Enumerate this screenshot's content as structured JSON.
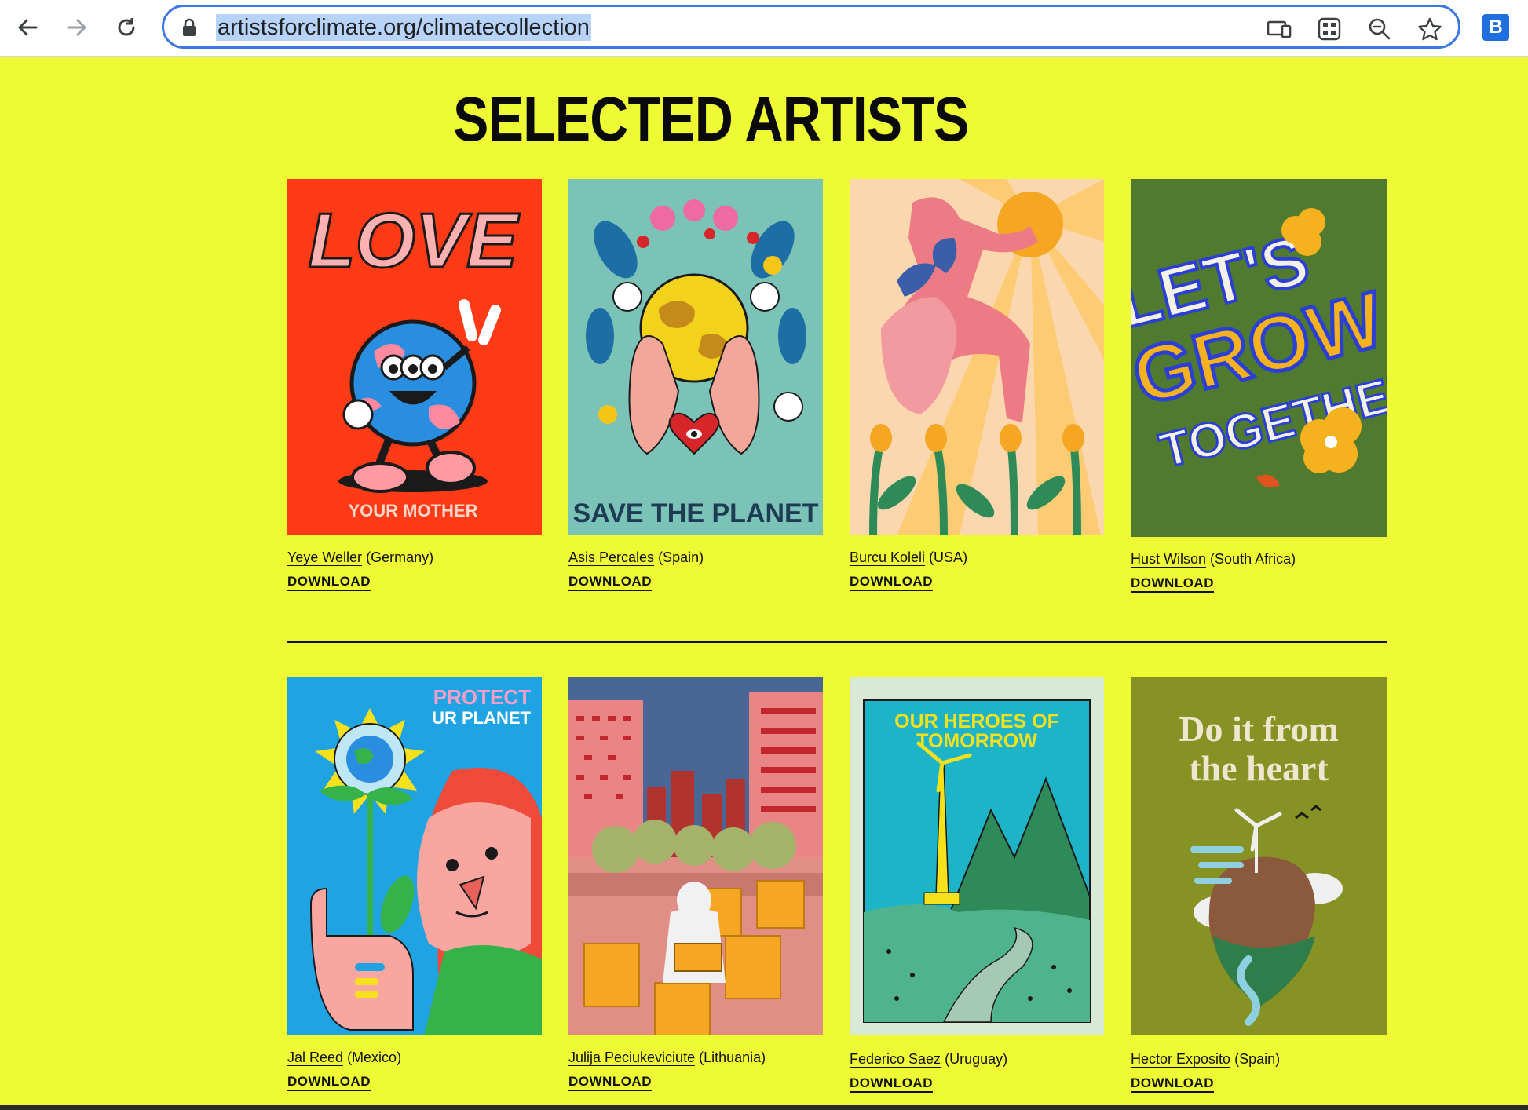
{
  "browser": {
    "url": "artistsforclimate.org/climatecollection",
    "icons": [
      "back-icon",
      "forward-icon",
      "reload-icon",
      "lock-icon",
      "cast-icon",
      "apps-icon",
      "zoom-icon",
      "bookmark-star-icon",
      "extension-icon"
    ],
    "extension_label": "B"
  },
  "page": {
    "title": "SELECTED ARTISTS"
  },
  "download_label": "DOWNLOAD",
  "artists": [
    {
      "name": "Yeye Weller",
      "country": "(Germany)",
      "poster_text": [
        "LOVE",
        "YOUR MOTHER"
      ]
    },
    {
      "name": "Asis Percales",
      "country": "(Spain)",
      "poster_text": [
        "SAVE THE PLANET"
      ]
    },
    {
      "name": "Burcu Koleli",
      "country": "(USA)",
      "poster_text": []
    },
    {
      "name": "Hust Wilson",
      "country": "(South Africa)",
      "poster_text": [
        "LET'S",
        "GROW",
        "TOGETHER"
      ]
    },
    {
      "name": "Jal Reed",
      "country": "(Mexico)",
      "poster_text": [
        "PROTECT",
        "UR PLANET"
      ]
    },
    {
      "name": "Julija Peciukeviciute",
      "country": "(Lithuania)",
      "poster_text": []
    },
    {
      "name": "Federico Saez",
      "country": "(Uruguay)",
      "poster_text": [
        "OUR HEROES OF",
        "TOMORROW"
      ]
    },
    {
      "name": "Hector Exposito",
      "country": "(Spain)",
      "poster_text": [
        "Do it from",
        "the heart"
      ]
    }
  ],
  "colors": {
    "page_background": "#eefb34",
    "omnibox_border": "#3b78e7",
    "url_highlight": "#b7d3f7"
  }
}
